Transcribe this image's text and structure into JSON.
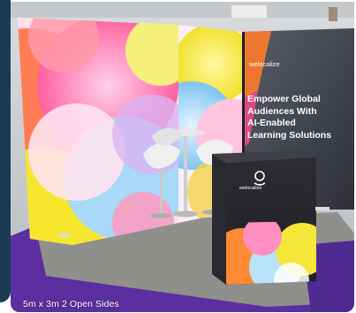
{
  "caption": "5m x 3m 2 Open Sides",
  "booth": {
    "brand": "welocalize",
    "headline_lines": [
      "Empower Global",
      "Audiences With",
      "AI-Enabled",
      "Learning Solutions"
    ]
  },
  "colors": {
    "frame_bar": "#1c3a52",
    "carpet": "#55309a",
    "floor_grey": "#8e8e8a",
    "panel_dark": "#3d3e46"
  }
}
